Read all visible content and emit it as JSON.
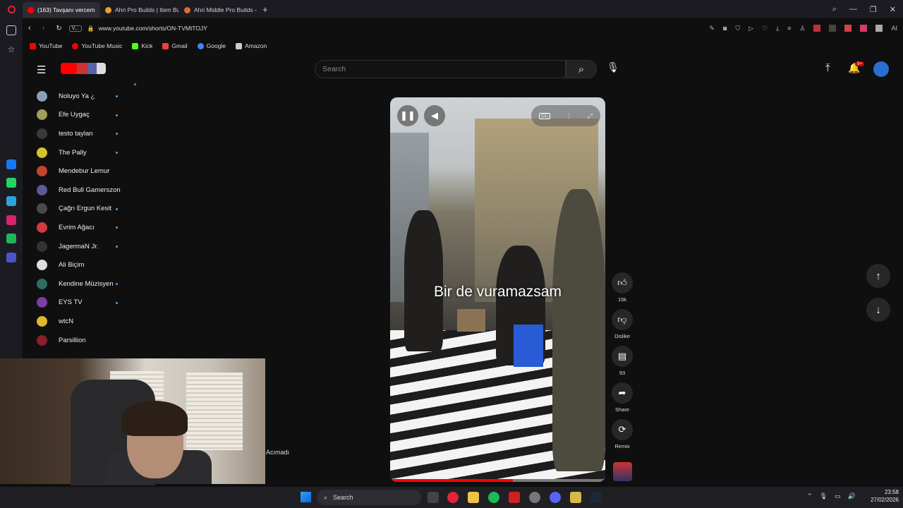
{
  "browser": {
    "tabs": [
      {
        "label": "(163) Tavşanı vercem",
        "active": true,
        "color": "#ff0000"
      },
      {
        "label": "Ahri Pro Builds | Item Buil...",
        "active": false,
        "color": "#e3a32b"
      },
      {
        "label": "Ahri Middle Pro Builds - P...",
        "active": false,
        "color": "#e36a2b"
      }
    ],
    "new_tab": "+",
    "url": "www.youtube.com/shorts/ON-TVMtTOJY",
    "site_badge": "V...",
    "bookmarks": [
      {
        "label": "YouTube",
        "color": "#ff0000"
      },
      {
        "label": "YouTube Music",
        "color": "#ff0000"
      },
      {
        "label": "Kick",
        "color": "#53fc18"
      },
      {
        "label": "Gmail",
        "color": "#ea4335"
      },
      {
        "label": "Google",
        "color": "#4285f4"
      },
      {
        "label": "Amazon",
        "color": "#cccccc"
      }
    ]
  },
  "youtube": {
    "search_placeholder": "Search",
    "notification_count": "9+",
    "subscriptions": [
      {
        "name": "Noluyo Ya ¿",
        "color": "#8aa0b8",
        "live": true
      },
      {
        "name": "Efe Uygaç",
        "color": "#a0a05a",
        "live": true
      },
      {
        "name": "testo taylan",
        "color": "#3a3a3a",
        "live": true
      },
      {
        "name": "The Pally",
        "color": "#d8c22a",
        "live": true
      },
      {
        "name": "Mendebur Lemur",
        "color": "#c4452f",
        "live": false
      },
      {
        "name": "Red Bull Gamerszon",
        "color": "#5b5b9a",
        "live": false
      },
      {
        "name": "Çağrı Ergun Kesit",
        "color": "#4a4a4a",
        "live": true
      },
      {
        "name": "Evrim Ağacı",
        "color": "#d33a3a",
        "live": true
      },
      {
        "name": "JagermaN Jr.",
        "color": "#333333",
        "live": true
      },
      {
        "name": "Ali Biçim",
        "color": "#dddddd",
        "live": false
      },
      {
        "name": "Kendine Müzisyen",
        "color": "#2f6e63",
        "live": true
      },
      {
        "name": "EYS TV",
        "color": "#7b3fa0",
        "live": true
      },
      {
        "name": "wtcN",
        "color": "#e3b52b",
        "live": false
      },
      {
        "name": "Parsillion",
        "color": "#8a1f2a",
        "live": false
      }
    ],
    "short": {
      "caption": "Bir de vuramazsam",
      "progress": 0.57
    },
    "actions": {
      "like_count": "15k",
      "dislike_label": "Dislike",
      "comment_count": "93",
      "share_label": "Share",
      "remix_label": "Remix"
    }
  },
  "overlay_text": "Acımadı",
  "taskbar": {
    "search_label": "Search",
    "time": "23:58",
    "date": "27/02/2026"
  }
}
